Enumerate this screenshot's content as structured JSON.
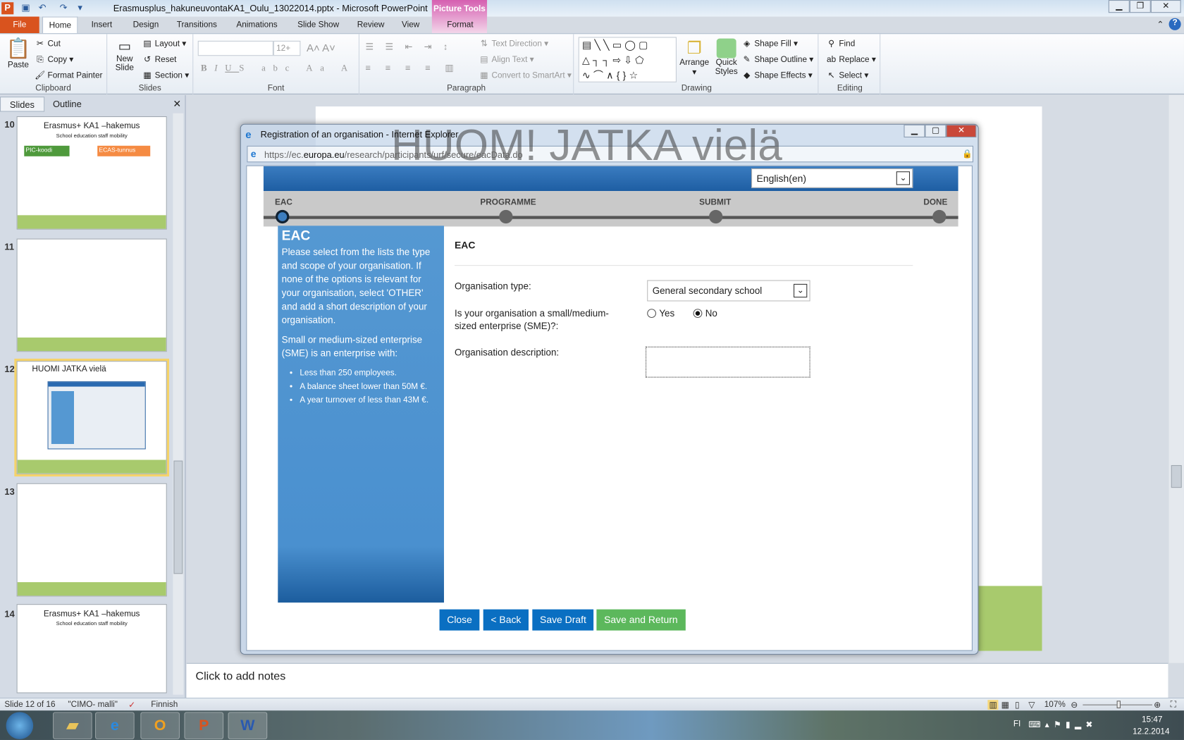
{
  "app": {
    "title": "Erasmusplus_hakuneuvontaKA1_Oulu_13022014.pptx - Microsoft PowerPoint",
    "context_tab": "Picture Tools"
  },
  "tabs": [
    "File",
    "Home",
    "Insert",
    "Design",
    "Transitions",
    "Animations",
    "Slide Show",
    "Review",
    "View",
    "Format"
  ],
  "ribbon": {
    "clipboard": {
      "label": "Clipboard",
      "paste": "Paste",
      "cut": "Cut",
      "copy": "Copy",
      "format_painter": "Format Painter"
    },
    "slides": {
      "label": "Slides",
      "new_slide": "New Slide",
      "layout": "Layout",
      "reset": "Reset",
      "section": "Section"
    },
    "font": {
      "label": "Font",
      "font_size": "12+"
    },
    "paragraph": {
      "label": "Paragraph",
      "text_direction": "Text Direction",
      "align_text": "Align Text",
      "convert_smartart": "Convert to SmartArt"
    },
    "drawing": {
      "label": "Drawing",
      "arrange": "Arrange",
      "quick_styles": "Quick Styles",
      "shape_fill": "Shape Fill",
      "shape_outline": "Shape Outline",
      "shape_effects": "Shape Effects"
    },
    "editing": {
      "label": "Editing",
      "find": "Find",
      "replace": "Replace",
      "select": "Select"
    }
  },
  "pane": {
    "tabs": [
      "Slides",
      "Outline"
    ],
    "thumbs": [
      {
        "num": "10",
        "title": "Erasmus+ KA1 –hakemus",
        "subtitle": "School education  staff mobility",
        "badges": [
          "PIC-koodi",
          "ECAS-tunnus"
        ]
      },
      {
        "num": "11",
        "title": "",
        "subtitle": ""
      },
      {
        "num": "12",
        "title": "HUOMI JATKA vielä",
        "subtitle": ""
      },
      {
        "num": "13",
        "title": "",
        "subtitle": ""
      },
      {
        "num": "14",
        "title": "Erasmus+ KA1 –hakemus",
        "subtitle": "School education  staff mobility"
      }
    ]
  },
  "slide": {
    "heading": "HUOM! JATKA vielä"
  },
  "ie": {
    "title": "Registration of an organisation - Internet Explorer",
    "url_prefix": "https://ec.",
    "url_domain": "europa.eu",
    "url_path": "/research/participants/urf/secure/eacData.do",
    "language": "English(en)",
    "steps": [
      "EAC",
      "PROGRAMME",
      "SUBMIT",
      "DONE"
    ],
    "sidebar": {
      "heading": "EAC",
      "p1": "Please select from the lists the type and scope of your organisation. If none of the options is relevant for your organisation, select 'OTHER' and add a short description of your organisation.",
      "p2": "Small or medium-sized enterprise (SME) is an enterprise with:",
      "bullets": [
        "Less than 250 employees.",
        "A balance sheet lower than 50M €.",
        "A year turnover of less than 43M €."
      ]
    },
    "form": {
      "heading": "EAC",
      "org_type_label": "Organisation type:",
      "org_type_value": "General secondary school",
      "sme_label": "Is your organisation a small/medium-sized enterprise (SME)?:",
      "yes": "Yes",
      "no": "No",
      "sme_value": "No",
      "desc_label": "Organisation description:",
      "desc_value": ""
    },
    "buttons": {
      "close": "Close",
      "back": "< Back",
      "save_draft": "Save Draft",
      "save_return": "Save and Return"
    }
  },
  "notes": {
    "placeholder": "Click to add notes"
  },
  "status": {
    "slide": "Slide 12 of 16",
    "theme": "\"CIMO- malli\"",
    "language": "Finnish",
    "zoom": "107%",
    "zoom_percent": 107
  },
  "taskbar": {
    "lang": "FI",
    "time": "15:47",
    "date": "12.2.2014"
  },
  "colors": {
    "file_tab": "#d9531e",
    "ie_blue": "#1e5ea3",
    "sidebar": "#4a90cf",
    "btn_blue": "#0a6fc2",
    "btn_green": "#5cb85c",
    "slide_green": "#a8ca6d"
  }
}
